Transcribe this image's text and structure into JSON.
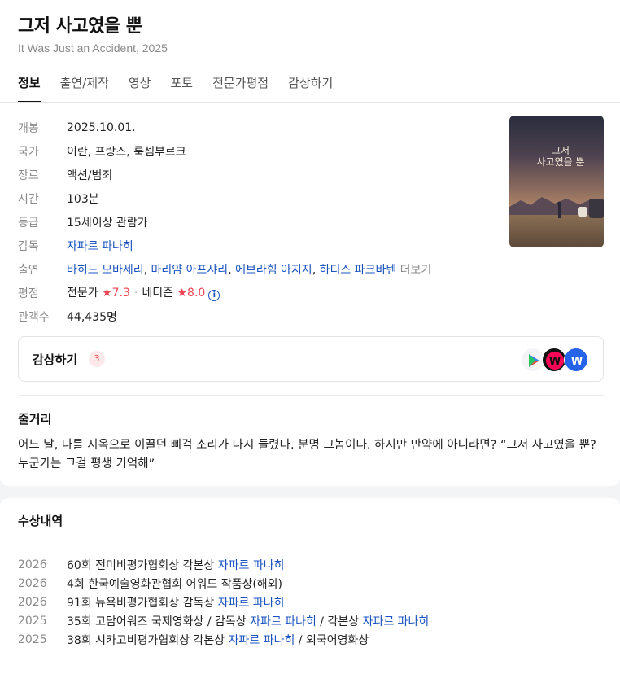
{
  "movie": {
    "title": "그저 사고였을 뿐",
    "subtitle": "It Was Just an Accident, 2025"
  },
  "tabs": [
    "정보",
    "출연/제작",
    "영상",
    "포토",
    "전문가평점",
    "감상하기"
  ],
  "active_tab": 0,
  "info": {
    "release_label": "개봉",
    "release": "2025.10.01.",
    "country_label": "국가",
    "country": "이란, 프랑스, 룩셈부르크",
    "genre_label": "장르",
    "genre": "액션/범죄",
    "runtime_label": "시간",
    "runtime": "103분",
    "rating_label": "등급",
    "rating": "15세이상 관람가",
    "director_label": "감독",
    "director": "자파르 파나히",
    "cast_label": "출연",
    "cast": [
      "바히드 모바세리",
      "마리얌 아프샤리",
      "에브라힘 아지지",
      "하디스 파크바텐"
    ],
    "cast_more": "더보기",
    "score_label": "평점",
    "critic_label": "전문가",
    "critic_score": "7.3",
    "netizen_label": "네티즌",
    "netizen_score": "8.0",
    "audience_label": "관객수",
    "audience": "44,435명"
  },
  "poster": {
    "title_line1": "그저",
    "title_line2": "사고였을 뿐"
  },
  "watch": {
    "label": "감상하기",
    "count": "3",
    "providers": [
      "play-store-icon",
      "watcha-icon",
      "wavve-icon"
    ]
  },
  "plot": {
    "title": "줄거리",
    "text": "어느 날, 나를 지옥으로 이끌던 삐걱 소리가 다시 들렸다. 분명 그놈이다. 하지만 만약에 아니라면? “그저 사고였을 뿐? 누군가는 그걸 평생 기억해”"
  },
  "awards": {
    "title": "수상내역",
    "items": [
      {
        "year": "2026",
        "parts": [
          {
            "t": "60회 전미비평가협회상 각본상 ",
            "link": false
          },
          {
            "t": "자파르 파나히",
            "link": true
          }
        ]
      },
      {
        "year": "2026",
        "parts": [
          {
            "t": "4회 한국예술영화관협회 어워드 작품상(해외)",
            "link": false
          }
        ]
      },
      {
        "year": "2026",
        "parts": [
          {
            "t": "91회 뉴욕비평가협회상 감독상 ",
            "link": false
          },
          {
            "t": "자파르 파나히",
            "link": true
          }
        ]
      },
      {
        "year": "2025",
        "parts": [
          {
            "t": "35회 고담어워즈 국제영화상 / 감독상 ",
            "link": false
          },
          {
            "t": "자파르 파나히",
            "link": true
          },
          {
            "t": " / 각본상 ",
            "link": false
          },
          {
            "t": "자파르 파나히",
            "link": true
          }
        ]
      },
      {
        "year": "2025",
        "parts": [
          {
            "t": "38회 시카고비평가협회상 각본상 ",
            "link": false
          },
          {
            "t": "자파르 파나히",
            "link": true
          },
          {
            "t": " / 외국어영화상",
            "link": false
          }
        ]
      }
    ]
  },
  "colors": {
    "link": "#1a53c0",
    "star": "#f04452",
    "muted": "#8a8a8a"
  }
}
